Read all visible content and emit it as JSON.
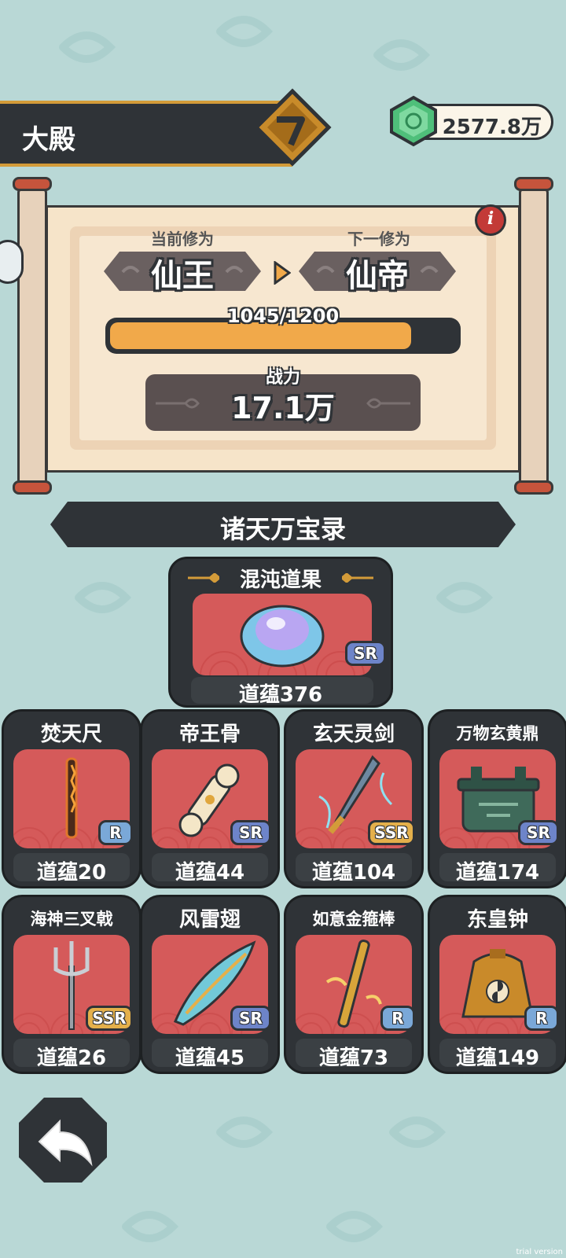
{
  "header": {
    "title": "大殿",
    "currency_icon": "jade-gem-icon",
    "currency_amount": "2577.8万"
  },
  "cultivation": {
    "current_label": "当前修为",
    "current_rank": "仙王",
    "next_label": "下一修为",
    "next_rank": "仙帝",
    "progress_text": "1045/1200",
    "progress_fraction": 0.871,
    "power_label": "战力",
    "power_value": "17.1万"
  },
  "section": {
    "title": "诸天万宝录"
  },
  "featured": {
    "name": "混沌道果",
    "rarity": "SR",
    "value": "道蕴376",
    "icon": "chaos-fruit-icon"
  },
  "treasures": [
    {
      "name": "焚天尺",
      "rarity": "R",
      "value": "道蕴20",
      "icon": "burning-ruler-icon"
    },
    {
      "name": "帝王骨",
      "rarity": "SR",
      "value": "道蕴44",
      "icon": "emperor-bone-icon"
    },
    {
      "name": "玄天灵剑",
      "rarity": "SSR",
      "value": "道蕴104",
      "icon": "spirit-sword-icon"
    },
    {
      "name": "万物玄黄鼎",
      "rarity": "SR",
      "value": "道蕴174",
      "icon": "bronze-cauldron-icon"
    },
    {
      "name": "海神三叉戟",
      "rarity": "SSR",
      "value": "道蕴26",
      "icon": "trident-icon"
    },
    {
      "name": "风雷翅",
      "rarity": "SR",
      "value": "道蕴45",
      "icon": "thunder-wing-icon"
    },
    {
      "name": "如意金箍棒",
      "rarity": "R",
      "value": "道蕴73",
      "icon": "golden-staff-icon"
    },
    {
      "name": "东皇钟",
      "rarity": "R",
      "value": "道蕴149",
      "icon": "donghuang-bell-icon"
    }
  ],
  "colors": {
    "background": "#b9d8d6",
    "panel_dark": "#2f3337",
    "accent_gold": "#d39b39",
    "card_art": "#d55a5a",
    "progress_fill": "#f1a94a"
  },
  "watermark": "trial version"
}
